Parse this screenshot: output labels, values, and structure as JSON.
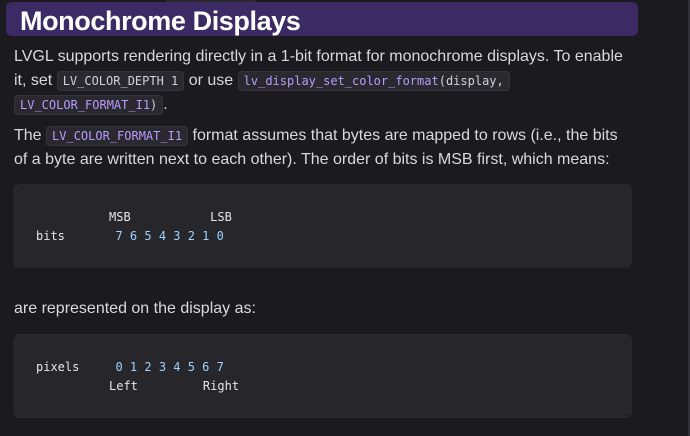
{
  "doc": {
    "title": "Monochrome Displays",
    "para1": {
      "text_a": "LVGL supports rendering directly in a 1-bit format for monochrome displays. To enable",
      "text_b": "it, set ",
      "code_a": "LV_COLOR_DEPTH 1",
      "text_c": " or use ",
      "code_fn": "lv_display_set_color_format",
      "code_fn_arg": "(display,",
      "code_const": "LV_COLOR_FORMAT_I1",
      "code_tail": ")",
      "text_end": "."
    },
    "para2": {
      "text_a": "The ",
      "code": "LV_COLOR_FORMAT_I1",
      "text_b": " format assumes that bytes are mapped to rows (i.e., the bits",
      "text_c": "of a byte are written next to each other). The order of bits is MSB first, which means:"
    },
    "code_block_1": {
      "line1": "MSB           LSB",
      "label": "bits",
      "values": "7 6 5 4 3 2 1 0"
    },
    "para3": "are represented on the display as:",
    "code_block_2": {
      "label": "pixels",
      "values": "0 1 2 3 4 5 6 7",
      "line2": "Left         Right"
    }
  }
}
